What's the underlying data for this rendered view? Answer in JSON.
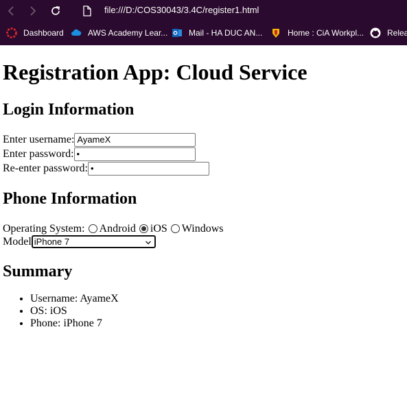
{
  "browser": {
    "url": "file:///D:/COS30043/3.4C/register1.html",
    "bookmarks": [
      {
        "label": "Dashboard",
        "icon": "dashboard-icon"
      },
      {
        "label": "AWS Academy Lear...",
        "icon": "cloud-icon"
      },
      {
        "label": "Mail - HA DUC AN...",
        "icon": "outlook-icon"
      },
      {
        "label": "Home : CiA Workpl...",
        "icon": "cia-icon"
      },
      {
        "label": "Relea",
        "icon": "github-icon"
      }
    ]
  },
  "page": {
    "title": "Registration App: Cloud Service",
    "login": {
      "heading": "Login Information",
      "username_label": "Enter username:",
      "username_value": "AyameX",
      "password_label": "Enter password:",
      "password_value": "•",
      "reenter_label": "Re-enter password:",
      "reenter_value": "•"
    },
    "phone": {
      "heading": "Phone Information",
      "os_label": "Operating System:",
      "os_options": [
        "Android",
        "iOS",
        "Windows"
      ],
      "os_selected": "iOS",
      "model_label": "Model",
      "model_value": "iPhone 7"
    },
    "summary": {
      "heading": "Summary",
      "items": [
        "Username: AyameX",
        "OS: iOS",
        "Phone: iPhone 7"
      ]
    }
  },
  "colors": {
    "chrome_bg": "#2a0a2e",
    "text": "#000000"
  }
}
